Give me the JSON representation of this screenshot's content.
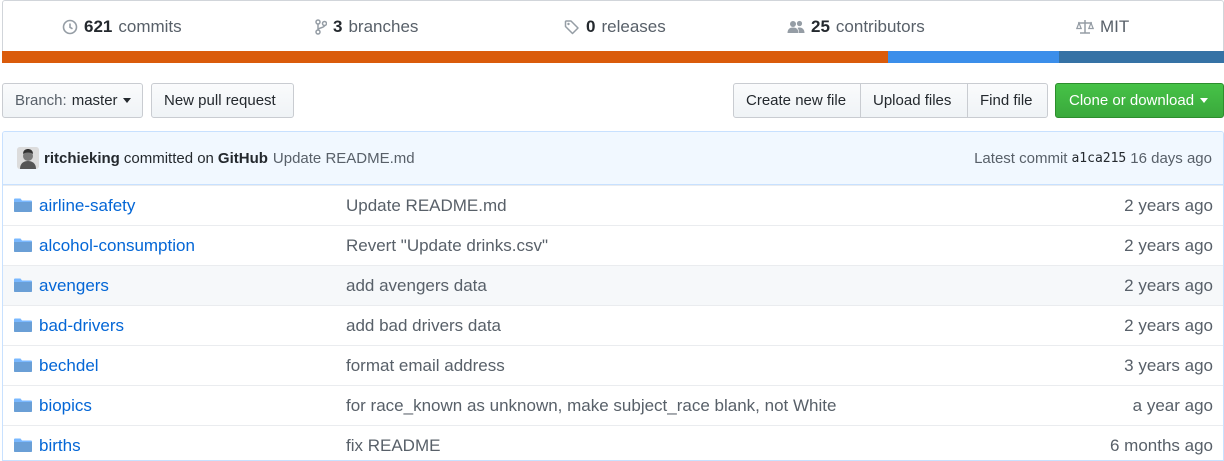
{
  "summary": {
    "commits": {
      "count": "621",
      "label": "commits"
    },
    "branches": {
      "count": "3",
      "label": "branches"
    },
    "releases": {
      "count": "0",
      "label": "releases"
    },
    "contributors": {
      "count": "25",
      "label": "contributors"
    },
    "license": {
      "label": "MIT"
    }
  },
  "language_bar": {
    "segments": [
      {
        "color": "#da5b0b",
        "share": 0.725
      },
      {
        "color": "#3b8eea",
        "share": 0.14
      },
      {
        "color": "#3572a5",
        "share": 0.135
      }
    ]
  },
  "toolbar": {
    "branch_prefix": "Branch:",
    "branch_name": "master",
    "new_pull_request": "New pull request",
    "create_new_file": "Create new file",
    "upload_files": "Upload files",
    "find_file": "Find file",
    "clone_or_download": "Clone or download"
  },
  "commit_tease": {
    "author": "ritchieking",
    "verb": "committed on",
    "committer": "GitHub",
    "message": "Update README.md",
    "latest_label": "Latest commit",
    "sha": "a1ca215",
    "age": "16 days ago"
  },
  "files": [
    {
      "name": "airline-safety",
      "message": "Update README.md",
      "age": "2 years ago"
    },
    {
      "name": "alcohol-consumption",
      "message": "Revert \"Update drinks.csv\"",
      "age": "2 years ago"
    },
    {
      "name": "avengers",
      "message": "add avengers data",
      "age": "2 years ago"
    },
    {
      "name": "bad-drivers",
      "message": "add bad drivers data",
      "age": "2 years ago"
    },
    {
      "name": "bechdel",
      "message": "format email address",
      "age": "3 years ago"
    },
    {
      "name": "biopics",
      "message": "for race_known as unknown, make subject_race blank, not White",
      "age": "a year ago"
    },
    {
      "name": "births",
      "message": "fix README",
      "age": "6 months ago"
    }
  ]
}
